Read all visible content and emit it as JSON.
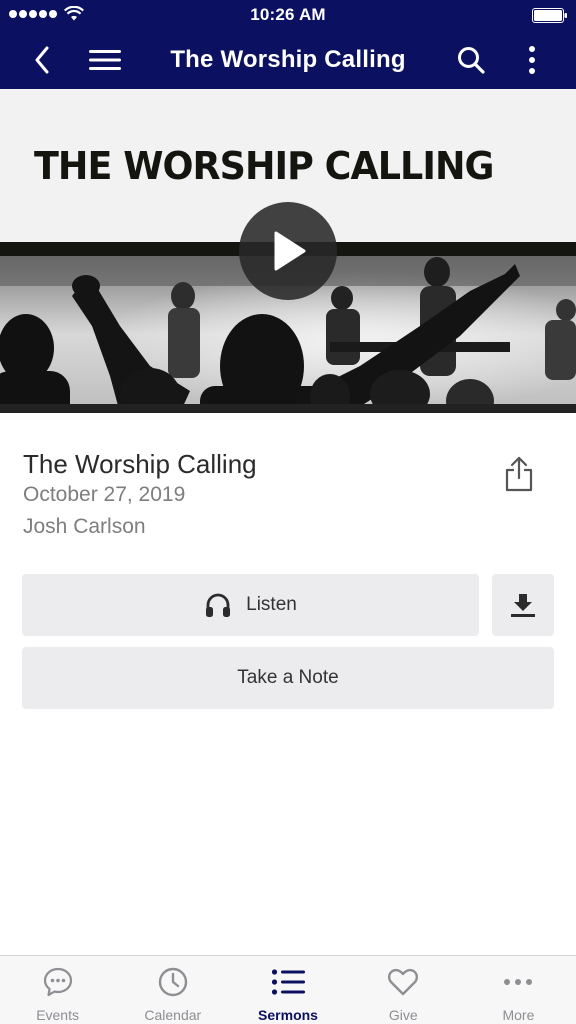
{
  "status_bar": {
    "time": "10:26 AM"
  },
  "nav": {
    "title": "The Worship Calling",
    "icons": [
      "back-icon",
      "menu-icon",
      "search-icon",
      "more-vertical-icon"
    ]
  },
  "hero": {
    "title": "THE WORSHIP CALLING",
    "play_icon": "play-icon"
  },
  "sermon": {
    "title": "The Worship Calling",
    "date": "October 27, 2019",
    "speaker": "Josh Carlson"
  },
  "actions": {
    "listen_label": "Listen",
    "note_label": "Take a Note"
  },
  "tabs": [
    {
      "label": "Events",
      "icon": "chat-bubble-icon",
      "active": false
    },
    {
      "label": "Calendar",
      "icon": "clock-icon",
      "active": false
    },
    {
      "label": "Sermons",
      "icon": "list-icon",
      "active": true
    },
    {
      "label": "Give",
      "icon": "heart-icon",
      "active": false
    },
    {
      "label": "More",
      "icon": "more-horizontal-icon",
      "active": false
    }
  ],
  "colors": {
    "nav_bg": "#0c1060",
    "active_tab": "#0c1060",
    "inactive_tab": "#8e8e93",
    "button_bg": "#ececee"
  }
}
